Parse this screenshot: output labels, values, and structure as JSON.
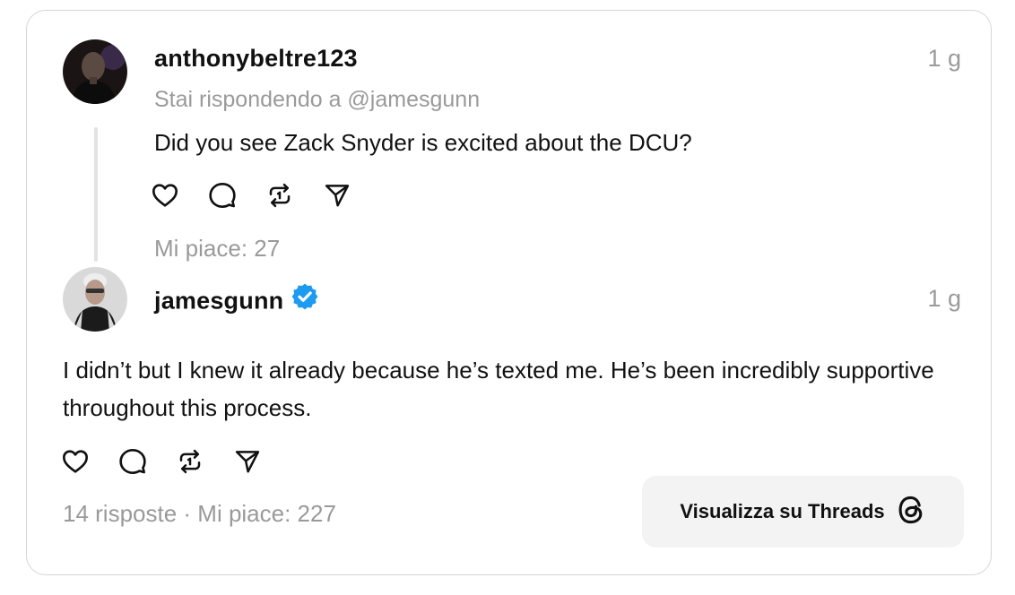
{
  "reply_post": {
    "username": "anthonybeltre123",
    "timestamp": "1 g",
    "replying_to": "Stai rispondendo a @jamesgunn",
    "text": "Did you see Zack Snyder is excited about the DCU?",
    "likes": "Mi piace: 27",
    "avatar_icon": "user-photo-dark"
  },
  "main_post": {
    "username": "jamesgunn",
    "verified_icon": "verified-badge-icon",
    "timestamp": "1 g",
    "text": "I didn’t but I knew it already because he’s texted me. He’s been incredibly supportive throughout this process.",
    "stats": "14 risposte · Mi piace: 227",
    "avatar_icon": "user-photo-grey"
  },
  "actions": {
    "like_icon": "heart-icon",
    "comment_icon": "comment-icon",
    "repost_icon": "repost-icon",
    "share_icon": "send-icon"
  },
  "view_button": {
    "label": "Visualizza su Threads",
    "icon": "threads-logo-icon"
  },
  "colors": {
    "muted": "#9a9a9a",
    "verified": "#1d9bf0",
    "button_bg": "#f3f3f3",
    "border": "#d6d6d6"
  }
}
